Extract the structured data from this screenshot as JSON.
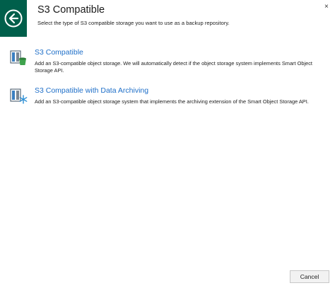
{
  "header": {
    "title": "S3 Compatible",
    "subtitle": "Select the type of S3 compatible storage you want to use as a backup repository.",
    "close_glyph": "×",
    "back_icon": "back-arrow-icon",
    "accent_color": "#005f4b"
  },
  "options": [
    {
      "title": "S3 Compatible",
      "description": "Add an S3-compatible object storage. We will automatically detect if the object storage system implements Smart Object Storage API.",
      "icon": "s3-compatible-storage-icon"
    },
    {
      "title": "S3 Compatible with Data Archiving",
      "description": "Add an S3-compatible object storage system that implements the archiving extension of the Smart Object Storage API.",
      "icon": "s3-archive-storage-icon"
    }
  ],
  "footer": {
    "cancel_label": "Cancel"
  }
}
